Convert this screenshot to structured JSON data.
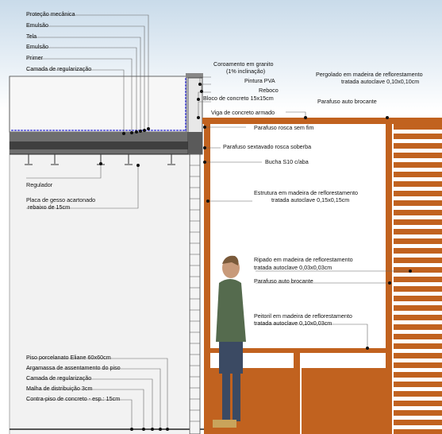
{
  "diagram": {
    "left_labels_top": [
      "Proteção mecânica",
      "Emulsão",
      "Tela",
      "Emulsão",
      "Primer",
      "Camada de regularização"
    ],
    "ceiling_labels": {
      "regulador": "Regulador",
      "placa_line1": "Placa de gesso acartonado",
      "placa_line2": "rebaixo de 15cm"
    },
    "floor_labels": [
      "Piso porcelanato Eliane 60x60cm",
      "Argamassa de assentamento do piso",
      "Camada de regularização",
      "Malha de distribuição 3cm",
      "Contra-piso de concreto - esp.: 15cm"
    ],
    "wall_labels": {
      "coroamento_line1": "Coroamento em granito",
      "coroamento_line2": "(1% inclinação)",
      "pintura": "Pintura PVA",
      "reboco": "Reboco",
      "bloco": "Bloco de concreto 15x15cm",
      "viga": "Viga de concreto armado"
    },
    "pergola_labels": {
      "pergolado_line1": "Pergolado em madeira de reflorestamento",
      "pergolado_line2": "tratada autoclave 0,10x0,10cm",
      "parafuso_auto": "Parafuso auto brocante",
      "parafuso_rosca": "Parafuso rosca sem fim",
      "parafuso_sextavado": "Parafuso sextavado rosca soberba",
      "bucha": "Bucha S10 c/aba",
      "estrutura_line1": "Estrutura em madeira de reflorestamento",
      "estrutura_line2": "tratada autoclave 0,15x0,15cm",
      "ripado_line1": "Ripado em madeira de reflorestamento",
      "ripado_line2": "tratada autoclave 0,03x0,03cm",
      "parafuso_auto_2": "Parafuso auto brocante",
      "peitoril_line1": "Peitoril em madeira de reflorestamento",
      "peitoril_line2": "tratada autoclave 0,10x0,03cm"
    },
    "colors": {
      "wood": "#c1621f",
      "wood_dark": "#9a4a14",
      "slab": "#6e6e6e",
      "slab_dark": "#3f3f3f",
      "membrane": "#4b4bd8",
      "sky": "#dce8f2"
    }
  }
}
